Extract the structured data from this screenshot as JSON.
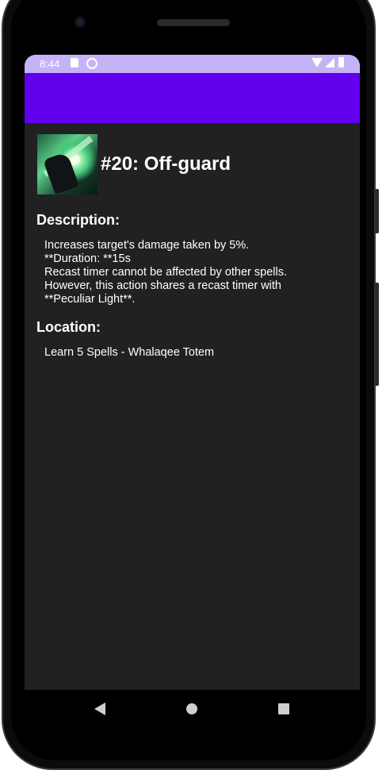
{
  "status_bar": {
    "time": "8:44"
  },
  "spell": {
    "title": "#20: Off-guard",
    "description_heading": "Description:",
    "description_lines": [
      "Increases target's damage taken by 5%.",
      "**Duration: **15s",
      "Recast timer cannot be affected by other spells.",
      "However, this action shares a recast timer with",
      "**Peculiar Light**."
    ],
    "location_heading": "Location:",
    "location": "Learn 5 Spells - Whalaqee Totem"
  },
  "icons": {
    "status": [
      "sd-card-icon",
      "sync-icon",
      "wifi-icon",
      "signal-icon",
      "battery-icon"
    ],
    "nav": [
      "back-icon",
      "home-icon",
      "recents-icon"
    ]
  },
  "colors": {
    "app_bar": "#6200ee",
    "status_bar": "#c5b3f7",
    "background": "#212121",
    "text": "#ffffff"
  }
}
